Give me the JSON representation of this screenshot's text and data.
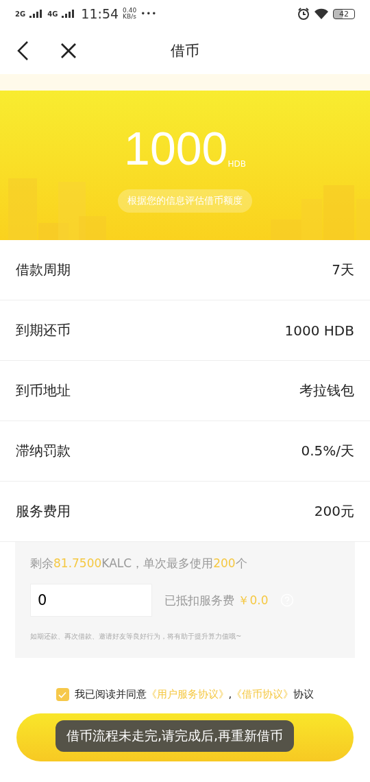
{
  "status_bar": {
    "network_1": "2G",
    "network_2": "4G",
    "time": "11:54",
    "speed_value": "0.40",
    "speed_unit": "KB/s",
    "more": "•••",
    "battery": "42"
  },
  "nav": {
    "title": "借币"
  },
  "hero": {
    "amount": "1000",
    "unit": "HDB",
    "note": "根据您的信息评估借币额度"
  },
  "rows": [
    {
      "label": "借款周期",
      "value": "7天"
    },
    {
      "label": "到期还币",
      "value": "1000 HDB"
    },
    {
      "label": "到币地址",
      "value": "考拉钱包"
    },
    {
      "label": "滞纳罚款",
      "value": "0.5%/天"
    },
    {
      "label": "服务费用",
      "value": "200元"
    }
  ],
  "deduction": {
    "remaining_prefix": "剩余",
    "remaining_amount": "81.7500",
    "remaining_middle": "KALC，单次最多使用",
    "max_amount": "200",
    "max_suffix": "个",
    "input_value": "0",
    "deducted_label": "已抵扣服务费",
    "deducted_amount": "￥0.0",
    "hint": "如期还款、再次借款、邀请好友等良好行为，将有助于提升算力值哦~"
  },
  "agreement": {
    "checked": true,
    "prefix": "我已阅读并同意",
    "links": [
      "《用户服务协议》",
      "《借币协议》"
    ],
    "separator": ",",
    "suffix": "协议"
  },
  "toast": {
    "text": "借币流程未走完,请完成后,再重新借币"
  }
}
